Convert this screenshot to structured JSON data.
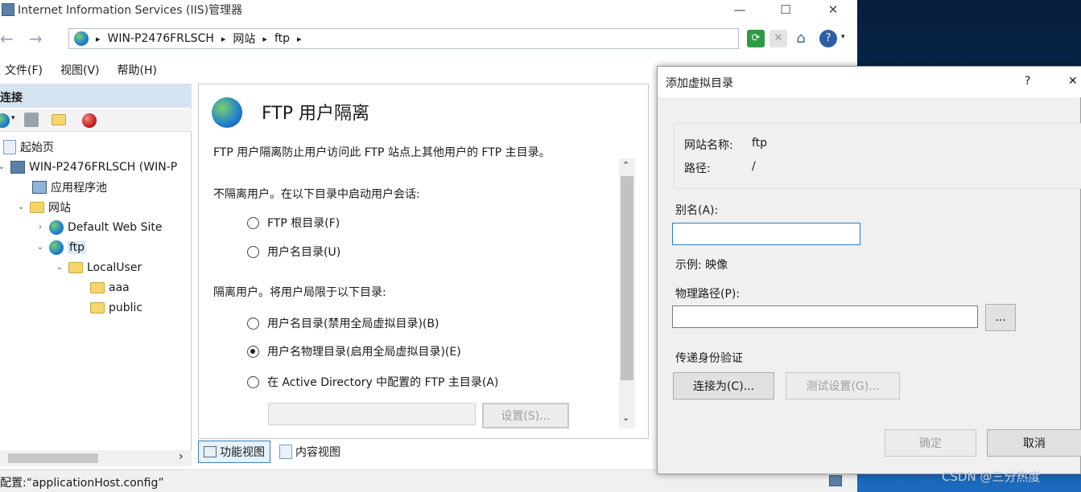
{
  "window": {
    "title": "Internet Information Services (IIS)管理器",
    "min": "—",
    "max": "☐",
    "close": "✕"
  },
  "address": {
    "back": "←",
    "forward": "→",
    "crumbs": [
      "WIN-P2476FRLSCH",
      "网站",
      "ftp"
    ],
    "sep": "▸"
  },
  "menu": [
    "文件(F)",
    "视图(V)",
    "帮助(H)"
  ],
  "connections": {
    "title": "连接",
    "tree": [
      {
        "label": "起始页",
        "icon": "start-page-icon"
      },
      {
        "label": "WIN-P2476FRLSCH (WIN-P",
        "icon": "server-icon"
      },
      {
        "label": "应用程序池",
        "icon": "app-pool-icon"
      },
      {
        "label": "网站",
        "icon": "sites-folder-icon"
      },
      {
        "label": "Default Web Site",
        "icon": "globe-icon"
      },
      {
        "label": "ftp",
        "icon": "globe-icon"
      },
      {
        "label": "LocalUser",
        "icon": "folder-icon"
      },
      {
        "label": "aaa",
        "icon": "folder-icon"
      },
      {
        "label": "public",
        "icon": "folder-icon"
      }
    ]
  },
  "feature": {
    "title": "FTP 用户隔离",
    "description": "FTP 用户隔离防止用户访问此 FTP 站点上其他用户的 FTP 主目录。",
    "no_isolation_heading": "不隔离用户。在以下目录中启动用户会话:",
    "opt_root": "FTP 根目录(F)",
    "opt_username": "用户名目录(U)",
    "isolation_heading": "隔离用户。将用户局限于以下目录:",
    "opt_username_noglobal": "用户名目录(禁用全局虚拟目录)(B)",
    "opt_physical": "用户名物理目录(启用全局虚拟目录)(E)",
    "opt_ad": "在 Active Directory 中配置的 FTP 主目录(A)",
    "selected": "opt_physical",
    "settings_button": "设置(S)..."
  },
  "view_tabs": [
    "功能视图",
    "内容视图"
  ],
  "status": "配置:“applicationHost.config”",
  "dialog": {
    "title": "添加虚拟目录",
    "help": "?",
    "close": "✕",
    "site_label": "网站名称:",
    "site_value": "ftp",
    "path_label": "路径:",
    "path_value": "/",
    "alias_label": "别名(A):",
    "alias_value": "",
    "example": "示例: 映像",
    "physical_label": "物理路径(P):",
    "physical_value": "",
    "browse": "...",
    "passthrough": "传递身份验证",
    "connect_as": "连接为(C)...",
    "test_settings": "测试设置(G)...",
    "ok": "确定",
    "cancel": "取消"
  },
  "watermark": "CSDN @三分热度"
}
